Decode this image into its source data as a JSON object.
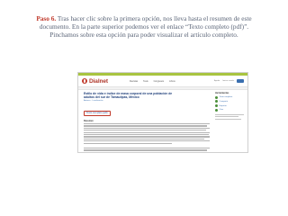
{
  "caption": {
    "step": "Paso 6.",
    "line1": " Tras hacer clic sobre la primera opción, nos lleva hasta el resumen de este",
    "line2": "documento. En la parte superior podemos ver el enlace “Texto completo (pdf)”.",
    "line3": "Pinchamos sobre esta opción para poder visualizar el artículo completo."
  },
  "screenshot": {
    "logo": "Dialnet",
    "nav": [
      "Revistas",
      "Tesis",
      "Congresos",
      "Libros"
    ],
    "top_links": [
      "Ayuda",
      "Iniciar sesión"
    ],
    "document_title": "Estilo de vida e índice de masa corporal de una población de adultos del sur de Tamaulipas, México",
    "authors": "Autores · Localización",
    "fulltext_link": "Texto completo (pdf)",
    "abstract_label": "Resumen",
    "side_title": "Herramientas",
    "side_items": [
      "Texto completo",
      "Compartir",
      "Exportar",
      "Citar"
    ]
  },
  "colors": {
    "brand_red": "#b03a2e",
    "brand_green": "#a8c440",
    "link_blue": "#3a6fb0",
    "caption_step": "#c0392b"
  }
}
